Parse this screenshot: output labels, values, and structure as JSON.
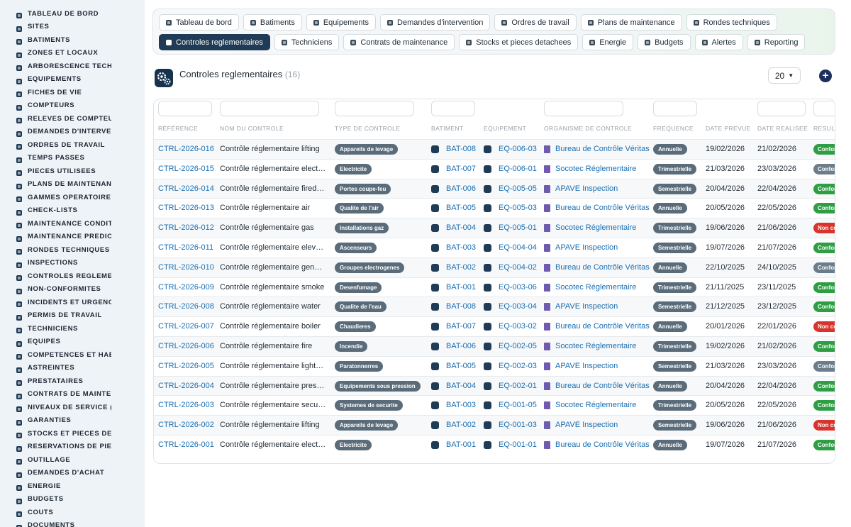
{
  "sidebar": {
    "items": [
      {
        "label": "TABLEAU DE BORD",
        "icon": "dashboard-icon"
      },
      {
        "label": "SITES",
        "icon": "map-pin-icon"
      },
      {
        "label": "BATIMENTS",
        "icon": "building-icon"
      },
      {
        "label": "ZONES ET LOCAUX",
        "icon": "grid-icon"
      },
      {
        "label": "ARBORESCENCE TECHNIQUE",
        "icon": "tree-icon"
      },
      {
        "label": "EQUIPEMENTS",
        "icon": "cogs-icon"
      },
      {
        "label": "FICHES DE VIE",
        "icon": "history-icon"
      },
      {
        "label": "COMPTEURS",
        "icon": "gauge-icon"
      },
      {
        "label": "RELEVES DE COMPTEURS",
        "icon": "list-icon"
      },
      {
        "label": "DEMANDES D'INTERVENTION",
        "icon": "question-icon"
      },
      {
        "label": "ORDRES DE TRAVAIL",
        "icon": "clipboard-icon"
      },
      {
        "label": "TEMPS PASSES",
        "icon": "clock-icon"
      },
      {
        "label": "PIECES UTILISEES",
        "icon": "boxes-icon"
      },
      {
        "label": "PLANS DE MAINTENANCE",
        "icon": "calendar-icon"
      },
      {
        "label": "GAMMES OPERATOIRES",
        "icon": "list-ol-icon"
      },
      {
        "label": "CHECK-LISTS",
        "icon": "checklist-icon"
      },
      {
        "label": "MAINTENANCE CONDITIONNELLE",
        "icon": "thermometer-icon"
      },
      {
        "label": "MAINTENANCE PREDICTIVE",
        "icon": "chart-icon"
      },
      {
        "label": "RONDES TECHNIQUES",
        "icon": "route-icon"
      },
      {
        "label": "INSPECTIONS",
        "icon": "search-icon"
      },
      {
        "label": "CONTROLES REGLEMENTAIRES",
        "icon": "clipboard-check-icon"
      },
      {
        "label": "NON-CONFORMITES",
        "icon": "alert-circle-icon"
      },
      {
        "label": "INCIDENTS ET URGENCES",
        "icon": "warning-icon"
      },
      {
        "label": "PERMIS DE TRAVAIL",
        "icon": "file-icon"
      },
      {
        "label": "TECHNICIENS",
        "icon": "hard-hat-icon"
      },
      {
        "label": "EQUIPES",
        "icon": "users-icon"
      },
      {
        "label": "COMPETENCES ET HABILITATIONS",
        "icon": "certificate-icon"
      },
      {
        "label": "ASTREINTES",
        "icon": "phone-icon"
      },
      {
        "label": "PRESTATAIRES",
        "icon": "handshake-icon"
      },
      {
        "label": "CONTRATS DE MAINTENANCE",
        "icon": "contract-icon"
      },
      {
        "label": "NIVEAUX DE SERVICE (SLA)",
        "icon": "stopwatch-icon"
      },
      {
        "label": "GARANTIES",
        "icon": "shield-icon"
      },
      {
        "label": "STOCKS ET PIECES DETACHEES",
        "icon": "warehouse-icon"
      },
      {
        "label": "RESERVATIONS DE PIECES",
        "icon": "bookmark-icon"
      },
      {
        "label": "OUTILLAGE",
        "icon": "wrench-icon"
      },
      {
        "label": "DEMANDES D'ACHAT",
        "icon": "cart-icon"
      },
      {
        "label": "ENERGIE",
        "icon": "bolt-icon"
      },
      {
        "label": "BUDGETS",
        "icon": "money-icon"
      },
      {
        "label": "COUTS",
        "icon": "coins-icon"
      },
      {
        "label": "DOCUMENTS",
        "icon": "document-icon"
      }
    ]
  },
  "topnav": {
    "row1": [
      {
        "label": "Tableau de bord",
        "icon": "dashboard-icon"
      },
      {
        "label": "Batiments",
        "icon": "building-icon"
      },
      {
        "label": "Equipements",
        "icon": "cogs-icon"
      },
      {
        "label": "Demandes d'intervention",
        "icon": "question-icon"
      },
      {
        "label": "Ordres de travail",
        "icon": "clipboard-icon"
      },
      {
        "label": "Plans de maintenance",
        "icon": "calendar-icon"
      },
      {
        "label": "Rondes techniques",
        "icon": "route-icon"
      }
    ],
    "row2": [
      {
        "label": "Controles reglementaires",
        "icon": "clipboard-check-icon",
        "active": true
      },
      {
        "label": "Techniciens",
        "icon": "hard-hat-icon"
      },
      {
        "label": "Contrats de maintenance",
        "icon": "contract-icon"
      },
      {
        "label": "Stocks et pieces detachees",
        "icon": "warehouse-icon"
      },
      {
        "label": "Energie",
        "icon": "bolt-icon"
      },
      {
        "label": "Budgets",
        "icon": "money-icon"
      },
      {
        "label": "Alertes",
        "icon": "bell-icon"
      },
      {
        "label": "Reporting",
        "icon": "pie-chart-icon"
      }
    ]
  },
  "page": {
    "title": "Controles reglementaires",
    "count": "(16)",
    "page_size": "20"
  },
  "table": {
    "headers": [
      "RÉFÉRENCE",
      "NOM DU CONTROLE",
      "TYPE DE CONTROLE",
      "BATIMENT",
      "EQUIPEMENT",
      "ORGANISME DE CONTROLE",
      "FREQUENCE",
      "DATE PREVUE",
      "DATE REALISEE",
      "RESULT"
    ],
    "rows": [
      {
        "ref": "CTRL-2026-016",
        "name": "Contrôle réglementaire lifting",
        "type": "Appareils de levage",
        "bat": "BAT-008",
        "eq": "EQ-006-03",
        "org": "Bureau de Contrôle Véritas",
        "freq": "Annuelle",
        "prevue": "19/02/2026",
        "realisee": "21/02/2026",
        "result": "Conforme",
        "status": "ok"
      },
      {
        "ref": "CTRL-2026-015",
        "name": "Contrôle réglementaire electrical",
        "type": "Electricite",
        "bat": "BAT-007",
        "eq": "EQ-006-01",
        "org": "Socotec Réglementaire",
        "freq": "Trimestrielle",
        "prevue": "21/03/2026",
        "realisee": "23/03/2026",
        "result": "Conforme",
        "status": "reserve"
      },
      {
        "ref": "CTRL-2026-014",
        "name": "Contrôle réglementaire firedoor",
        "type": "Portes coupe-feu",
        "bat": "BAT-006",
        "eq": "EQ-005-05",
        "org": "APAVE Inspection",
        "freq": "Semestrielle",
        "prevue": "20/04/2026",
        "realisee": "22/04/2026",
        "result": "Conforme",
        "status": "ok"
      },
      {
        "ref": "CTRL-2026-013",
        "name": "Contrôle réglementaire air",
        "type": "Qualite de l'air",
        "bat": "BAT-005",
        "eq": "EQ-005-03",
        "org": "Bureau de Contrôle Véritas",
        "freq": "Annuelle",
        "prevue": "20/05/2026",
        "realisee": "22/05/2026",
        "result": "Conforme",
        "status": "ok"
      },
      {
        "ref": "CTRL-2026-012",
        "name": "Contrôle réglementaire gas",
        "type": "Installations gaz",
        "bat": "BAT-004",
        "eq": "EQ-005-01",
        "org": "Socotec Réglementaire",
        "freq": "Trimestrielle",
        "prevue": "19/06/2026",
        "realisee": "21/06/2026",
        "result": "Non conforme",
        "status": "ko"
      },
      {
        "ref": "CTRL-2026-011",
        "name": "Contrôle réglementaire elevator",
        "type": "Ascenseurs",
        "bat": "BAT-003",
        "eq": "EQ-004-04",
        "org": "APAVE Inspection",
        "freq": "Semestrielle",
        "prevue": "19/07/2026",
        "realisee": "21/07/2026",
        "result": "Conforme",
        "status": "ok"
      },
      {
        "ref": "CTRL-2026-010",
        "name": "Contrôle réglementaire generator",
        "type": "Groupes electrogenes",
        "bat": "BAT-002",
        "eq": "EQ-004-02",
        "org": "Bureau de Contrôle Véritas",
        "freq": "Annuelle",
        "prevue": "22/10/2025",
        "realisee": "24/10/2025",
        "result": "Conforme",
        "status": "reserve"
      },
      {
        "ref": "CTRL-2026-009",
        "name": "Contrôle réglementaire smoke",
        "type": "Desenfumage",
        "bat": "BAT-001",
        "eq": "EQ-003-06",
        "org": "Socotec Réglementaire",
        "freq": "Trimestrielle",
        "prevue": "21/11/2025",
        "realisee": "23/11/2025",
        "result": "Conforme",
        "status": "ok"
      },
      {
        "ref": "CTRL-2026-008",
        "name": "Contrôle réglementaire water",
        "type": "Qualite de l'eau",
        "bat": "BAT-008",
        "eq": "EQ-003-04",
        "org": "APAVE Inspection",
        "freq": "Semestrielle",
        "prevue": "21/12/2025",
        "realisee": "23/12/2025",
        "result": "Conforme",
        "status": "ok"
      },
      {
        "ref": "CTRL-2026-007",
        "name": "Contrôle réglementaire boiler",
        "type": "Chaudieres",
        "bat": "BAT-007",
        "eq": "EQ-003-02",
        "org": "Bureau de Contrôle Véritas",
        "freq": "Annuelle",
        "prevue": "20/01/2026",
        "realisee": "22/01/2026",
        "result": "Non conforme",
        "status": "ko"
      },
      {
        "ref": "CTRL-2026-006",
        "name": "Contrôle réglementaire fire",
        "type": "Incendie",
        "bat": "BAT-006",
        "eq": "EQ-002-05",
        "org": "Socotec Réglementaire",
        "freq": "Trimestrielle",
        "prevue": "19/02/2026",
        "realisee": "21/02/2026",
        "result": "Conforme",
        "status": "ok"
      },
      {
        "ref": "CTRL-2026-005",
        "name": "Contrôle réglementaire lightning",
        "type": "Paratonnerres",
        "bat": "BAT-005",
        "eq": "EQ-002-03",
        "org": "APAVE Inspection",
        "freq": "Semestrielle",
        "prevue": "21/03/2026",
        "realisee": "23/03/2026",
        "result": "Conforme",
        "status": "reserve"
      },
      {
        "ref": "CTRL-2026-004",
        "name": "Contrôle réglementaire pressure",
        "type": "Equipements sous pression",
        "bat": "BAT-004",
        "eq": "EQ-002-01",
        "org": "Bureau de Contrôle Véritas",
        "freq": "Annuelle",
        "prevue": "20/04/2026",
        "realisee": "22/04/2026",
        "result": "Conforme",
        "status": "ok"
      },
      {
        "ref": "CTRL-2026-003",
        "name": "Contrôle réglementaire security",
        "type": "Systemes de securite",
        "bat": "BAT-003",
        "eq": "EQ-001-05",
        "org": "Socotec Réglementaire",
        "freq": "Trimestrielle",
        "prevue": "20/05/2026",
        "realisee": "22/05/2026",
        "result": "Conforme",
        "status": "ok"
      },
      {
        "ref": "CTRL-2026-002",
        "name": "Contrôle réglementaire lifting",
        "type": "Appareils de levage",
        "bat": "BAT-002",
        "eq": "EQ-001-03",
        "org": "APAVE Inspection",
        "freq": "Semestrielle",
        "prevue": "19/06/2026",
        "realisee": "21/06/2026",
        "result": "Non conforme",
        "status": "ko"
      },
      {
        "ref": "CTRL-2026-001",
        "name": "Contrôle réglementaire electrical",
        "type": "Electricite",
        "bat": "BAT-001",
        "eq": "EQ-001-01",
        "org": "Bureau de Contrôle Véritas",
        "freq": "Annuelle",
        "prevue": "19/07/2026",
        "realisee": "21/07/2026",
        "result": "Conforme",
        "status": "ok"
      }
    ]
  },
  "colors": {
    "accent": "#1f3b55",
    "link": "#1a6fb3",
    "ok": "#2e9e44",
    "ko": "#d8342c",
    "reserve": "#6b7c8a",
    "badge": "#5a6b79"
  }
}
